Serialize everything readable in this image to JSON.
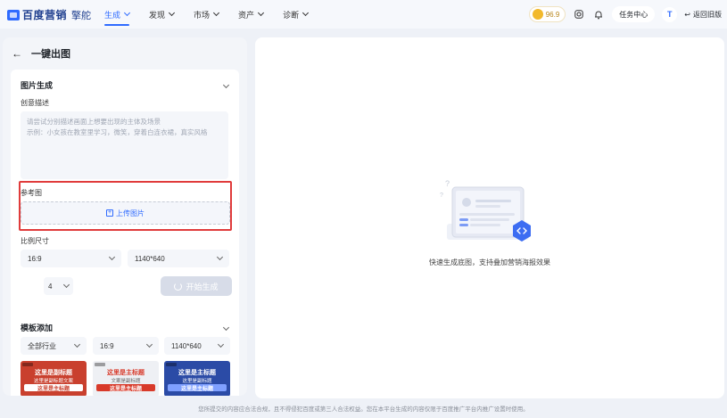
{
  "app": {
    "brand": "百度营销",
    "product": "擎舵"
  },
  "nav": {
    "items": [
      {
        "label": "生成",
        "active": true
      },
      {
        "label": "发现",
        "active": false
      },
      {
        "label": "市场",
        "active": false
      },
      {
        "label": "资产",
        "active": false
      },
      {
        "label": "诊断",
        "active": false
      }
    ]
  },
  "header": {
    "score": "96.9",
    "task_center": "任务中心",
    "avatar_letter": "T",
    "back_old": "返回旧版"
  },
  "left_panel": {
    "title": "一键出图",
    "image_gen": {
      "section_title": "图片生成",
      "creative_label": "创意描述",
      "creative_placeholder_line1": "请尝试分别描述画面上想要出现的主体及场景",
      "creative_placeholder_line2": "示例：小女孩在教室里学习，微笑，穿着白连衣裙，真实风格",
      "reference_label": "参考图",
      "upload_label": "上传图片",
      "ratio_label": "比例尺寸",
      "ratio_value": "16:9",
      "size_value": "1140*640",
      "count_value": "4",
      "generate_label": "开始生成"
    },
    "template": {
      "section_title": "模板添加",
      "industry_value": "全部行业",
      "ratio_value": "16:9",
      "size_value": "1140*640",
      "thumbs": [
        {
          "title": "这里是副标题",
          "sub": "这里是副标题文案",
          "tag": "这里是主标题"
        },
        {
          "title": "这里是主标题",
          "sub": "文案是副标题",
          "tag": "这里是主标题"
        },
        {
          "title": "这里是主标题",
          "sub": "这里是副标题",
          "tag": "这里是主标题"
        }
      ]
    }
  },
  "right_panel": {
    "empty_text": "快速生成底图，支持叠加营销海报效果"
  },
  "footer": {
    "notice": "您所提交的内容应合法合规，且不得侵犯百度或第三人合法权益。您在本平台生成的内容仅限于百度推广平台内推广设置时使用。"
  },
  "colors": {
    "accent": "#2f6bff",
    "highlight_border": "#e03b3b",
    "background": "#eef1f7"
  }
}
